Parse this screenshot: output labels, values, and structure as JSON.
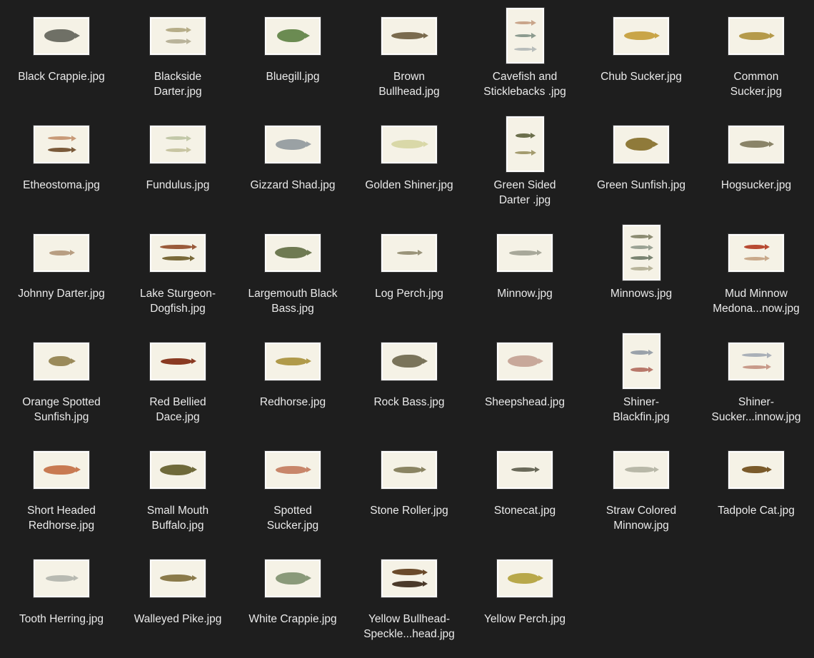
{
  "files": [
    {
      "name": "Black Crappie.jpg",
      "thumb": "land",
      "fish": [
        {
          "color": "#6f7066",
          "w": 44,
          "h": 18
        }
      ]
    },
    {
      "name": "Blackside\nDarter.jpg",
      "thumb": "land",
      "fish": [
        {
          "color": "#b6ad88",
          "w": 30,
          "h": 6
        },
        {
          "color": "#b9b39a",
          "w": 30,
          "h": 6
        }
      ]
    },
    {
      "name": "Bluegill.jpg",
      "thumb": "land",
      "fish": [
        {
          "color": "#6b8b52",
          "w": 40,
          "h": 18
        }
      ]
    },
    {
      "name": "Brown\nBullhead.jpg",
      "thumb": "land",
      "fish": [
        {
          "color": "#7a6b4e",
          "w": 46,
          "h": 10
        }
      ]
    },
    {
      "name": "Cavefish and\nSticklebacks .jpg",
      "thumb": "port",
      "fish": [
        {
          "color": "#c9a58a",
          "w": 24,
          "h": 4
        },
        {
          "color": "#8c9b8f",
          "w": 24,
          "h": 4
        },
        {
          "color": "#b8bdbb",
          "w": 26,
          "h": 4
        }
      ]
    },
    {
      "name": "Chub Sucker.jpg",
      "thumb": "land",
      "fish": [
        {
          "color": "#c9a548",
          "w": 44,
          "h": 12
        }
      ]
    },
    {
      "name": "Common\nSucker.jpg",
      "thumb": "land",
      "fish": [
        {
          "color": "#b59a4a",
          "w": 44,
          "h": 11
        }
      ]
    },
    {
      "name": "Etheostoma.jpg",
      "thumb": "land",
      "fish": [
        {
          "color": "#c89a78",
          "w": 34,
          "h": 5
        },
        {
          "color": "#7a5a3a",
          "w": 34,
          "h": 6
        }
      ]
    },
    {
      "name": "Fundulus.jpg",
      "thumb": "land",
      "fish": [
        {
          "color": "#c2c8a8",
          "w": 30,
          "h": 5
        },
        {
          "color": "#c8c5a2",
          "w": 30,
          "h": 5
        }
      ]
    },
    {
      "name": "Gizzard Shad.jpg",
      "thumb": "land",
      "fish": [
        {
          "color": "#9aa1a4",
          "w": 44,
          "h": 15
        }
      ]
    },
    {
      "name": "Golden Shiner.jpg",
      "thumb": "land",
      "fish": [
        {
          "color": "#d9d8a8",
          "w": 46,
          "h": 12
        }
      ]
    },
    {
      "name": "Green Sided\nDarter .jpg",
      "thumb": "port",
      "fish": [
        {
          "color": "#6b6f4c",
          "w": 22,
          "h": 6
        },
        {
          "color": "#a39b6e",
          "w": 24,
          "h": 4
        }
      ]
    },
    {
      "name": "Green Sunfish.jpg",
      "thumb": "land",
      "fish": [
        {
          "color": "#8f7a3a",
          "w": 40,
          "h": 18
        }
      ]
    },
    {
      "name": "Hogsucker.jpg",
      "thumb": "land",
      "fish": [
        {
          "color": "#8a8468",
          "w": 42,
          "h": 10
        }
      ]
    },
    {
      "name": "Johnny Darter.jpg",
      "thumb": "land",
      "fish": [
        {
          "color": "#b89e82",
          "w": 30,
          "h": 7
        }
      ]
    },
    {
      "name": "Lake Sturgeon-\nDogfish.jpg",
      "thumb": "land",
      "fish": [
        {
          "color": "#9a5a3a",
          "w": 46,
          "h": 6
        },
        {
          "color": "#7a6a3a",
          "w": 40,
          "h": 6
        }
      ]
    },
    {
      "name": "Largemouth Black\nBass.jpg",
      "thumb": "land",
      "fish": [
        {
          "color": "#6f7a52",
          "w": 46,
          "h": 16
        }
      ]
    },
    {
      "name": "Log Perch.jpg",
      "thumb": "land",
      "fish": [
        {
          "color": "#9a947a",
          "w": 30,
          "h": 5
        }
      ]
    },
    {
      "name": "Minnow.jpg",
      "thumb": "land",
      "fish": [
        {
          "color": "#a8a89a",
          "w": 40,
          "h": 7
        }
      ]
    },
    {
      "name": "Minnows.jpg",
      "thumb": "port",
      "fish": [
        {
          "color": "#8c8c72",
          "w": 26,
          "h": 5
        },
        {
          "color": "#9aa294",
          "w": 26,
          "h": 5
        },
        {
          "color": "#7a8472",
          "w": 26,
          "h": 5
        },
        {
          "color": "#b8b49a",
          "w": 26,
          "h": 5
        }
      ]
    },
    {
      "name": "Mud Minnow\nMedona...now.jpg",
      "thumb": "land",
      "fish": [
        {
          "color": "#b84a32",
          "w": 30,
          "h": 6
        },
        {
          "color": "#c9a98a",
          "w": 30,
          "h": 5
        }
      ]
    },
    {
      "name": "Orange Spotted\nSunfish.jpg",
      "thumb": "land",
      "fish": [
        {
          "color": "#9a8a5a",
          "w": 32,
          "h": 14
        }
      ]
    },
    {
      "name": "Red Bellied\nDace.jpg",
      "thumb": "land",
      "fish": [
        {
          "color": "#8a3a22",
          "w": 44,
          "h": 9
        }
      ]
    },
    {
      "name": "Redhorse.jpg",
      "thumb": "land",
      "fish": [
        {
          "color": "#b09a4a",
          "w": 44,
          "h": 11
        }
      ]
    },
    {
      "name": "Rock Bass.jpg",
      "thumb": "land",
      "fish": [
        {
          "color": "#7a745a",
          "w": 44,
          "h": 18
        }
      ]
    },
    {
      "name": "Sheepshead.jpg",
      "thumb": "land",
      "fish": [
        {
          "color": "#c8a89a",
          "w": 44,
          "h": 16
        }
      ]
    },
    {
      "name": "Shiner-\nBlackfin.jpg",
      "thumb": "port",
      "fish": [
        {
          "color": "#9aa2aa",
          "w": 26,
          "h": 6
        },
        {
          "color": "#b8786a",
          "w": 26,
          "h": 6
        }
      ]
    },
    {
      "name": "Shiner-\nSucker...innow.jpg",
      "thumb": "land",
      "fish": [
        {
          "color": "#aab0b8",
          "w": 36,
          "h": 5
        },
        {
          "color": "#c89a8a",
          "w": 34,
          "h": 5
        }
      ]
    },
    {
      "name": "Short Headed\nRedhorse.jpg",
      "thumb": "land",
      "fish": [
        {
          "color": "#c87a52",
          "w": 46,
          "h": 13
        }
      ]
    },
    {
      "name": "Small Mouth\nBuffalo.jpg",
      "thumb": "land",
      "fish": [
        {
          "color": "#6f6a3a",
          "w": 46,
          "h": 15
        }
      ]
    },
    {
      "name": "Spotted\nSucker.jpg",
      "thumb": "land",
      "fish": [
        {
          "color": "#c8866a",
          "w": 44,
          "h": 11
        }
      ]
    },
    {
      "name": "Stone Roller.jpg",
      "thumb": "land",
      "fish": [
        {
          "color": "#8a8462",
          "w": 40,
          "h": 9
        }
      ]
    },
    {
      "name": "Stonecat.jpg",
      "thumb": "land",
      "fish": [
        {
          "color": "#6a6a5a",
          "w": 34,
          "h": 6
        }
      ]
    },
    {
      "name": "Straw Colored\nMinnow.jpg",
      "thumb": "land",
      "fish": [
        {
          "color": "#b8b8a8",
          "w": 42,
          "h": 8
        }
      ]
    },
    {
      "name": "Tadpole Cat.jpg",
      "thumb": "land",
      "fish": [
        {
          "color": "#7a5a2a",
          "w": 36,
          "h": 10
        }
      ]
    },
    {
      "name": "Tooth Herring.jpg",
      "thumb": "land",
      "fish": [
        {
          "color": "#b8bab2",
          "w": 40,
          "h": 9
        }
      ]
    },
    {
      "name": "Walleyed Pike.jpg",
      "thumb": "land",
      "fish": [
        {
          "color": "#8a7a4a",
          "w": 46,
          "h": 10
        }
      ]
    },
    {
      "name": "White Crappie.jpg",
      "thumb": "land",
      "fish": [
        {
          "color": "#8a9a7a",
          "w": 44,
          "h": 17
        }
      ]
    },
    {
      "name": "Yellow Bullhead-\nSpeckle...head.jpg",
      "thumb": "land",
      "fish": [
        {
          "color": "#6a4a2a",
          "w": 44,
          "h": 9
        },
        {
          "color": "#4a3a2a",
          "w": 44,
          "h": 9
        }
      ]
    },
    {
      "name": "Yellow Perch.jpg",
      "thumb": "land",
      "fish": [
        {
          "color": "#b8a84a",
          "w": 44,
          "h": 15
        }
      ]
    }
  ]
}
